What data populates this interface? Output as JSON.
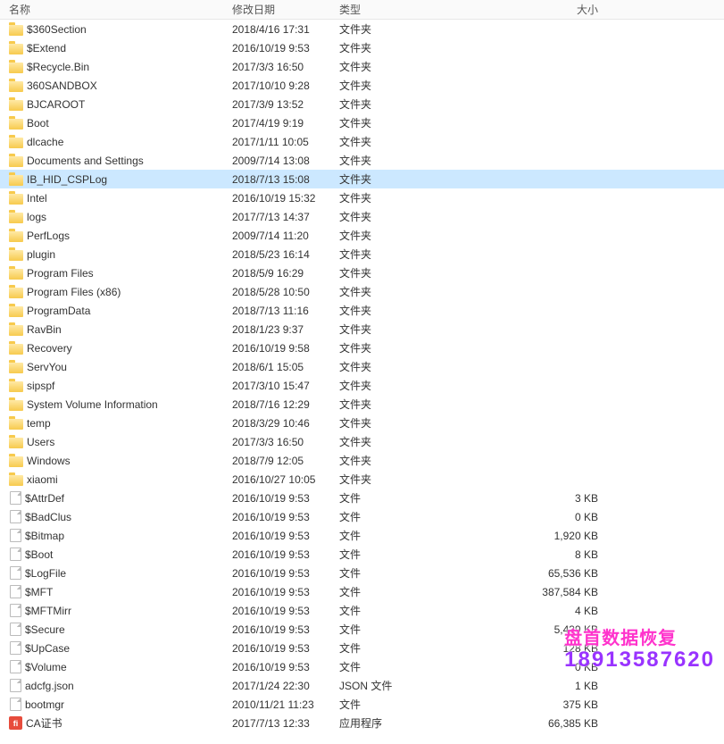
{
  "headers": {
    "name": "名称",
    "date": "修改日期",
    "type": "类型",
    "size": "大小"
  },
  "selected_index": 8,
  "watermark": {
    "line1": "盘首数据恢复",
    "line2": "18913587620"
  },
  "files": [
    {
      "icon": "folder",
      "name": "$360Section",
      "date": "2018/4/16 17:31",
      "type": "文件夹",
      "size": ""
    },
    {
      "icon": "folder",
      "name": "$Extend",
      "date": "2016/10/19 9:53",
      "type": "文件夹",
      "size": ""
    },
    {
      "icon": "folder",
      "name": "$Recycle.Bin",
      "date": "2017/3/3 16:50",
      "type": "文件夹",
      "size": ""
    },
    {
      "icon": "folder",
      "name": "360SANDBOX",
      "date": "2017/10/10 9:28",
      "type": "文件夹",
      "size": ""
    },
    {
      "icon": "folder",
      "name": "BJCAROOT",
      "date": "2017/3/9 13:52",
      "type": "文件夹",
      "size": ""
    },
    {
      "icon": "folder",
      "name": "Boot",
      "date": "2017/4/19 9:19",
      "type": "文件夹",
      "size": ""
    },
    {
      "icon": "folder",
      "name": "dlcache",
      "date": "2017/1/11 10:05",
      "type": "文件夹",
      "size": ""
    },
    {
      "icon": "folder",
      "name": "Documents and Settings",
      "date": "2009/7/14 13:08",
      "type": "文件夹",
      "size": ""
    },
    {
      "icon": "folder",
      "name": "IB_HID_CSPLog",
      "date": "2018/7/13 15:08",
      "type": "文件夹",
      "size": ""
    },
    {
      "icon": "folder",
      "name": "Intel",
      "date": "2016/10/19 15:32",
      "type": "文件夹",
      "size": ""
    },
    {
      "icon": "folder",
      "name": "logs",
      "date": "2017/7/13 14:37",
      "type": "文件夹",
      "size": ""
    },
    {
      "icon": "folder",
      "name": "PerfLogs",
      "date": "2009/7/14 11:20",
      "type": "文件夹",
      "size": ""
    },
    {
      "icon": "folder",
      "name": "plugin",
      "date": "2018/5/23 16:14",
      "type": "文件夹",
      "size": ""
    },
    {
      "icon": "folder",
      "name": "Program Files",
      "date": "2018/5/9 16:29",
      "type": "文件夹",
      "size": ""
    },
    {
      "icon": "folder",
      "name": "Program Files (x86)",
      "date": "2018/5/28 10:50",
      "type": "文件夹",
      "size": ""
    },
    {
      "icon": "folder",
      "name": "ProgramData",
      "date": "2018/7/13 11:16",
      "type": "文件夹",
      "size": ""
    },
    {
      "icon": "folder",
      "name": "RavBin",
      "date": "2018/1/23 9:37",
      "type": "文件夹",
      "size": ""
    },
    {
      "icon": "folder",
      "name": "Recovery",
      "date": "2016/10/19 9:58",
      "type": "文件夹",
      "size": ""
    },
    {
      "icon": "folder",
      "name": "ServYou",
      "date": "2018/6/1 15:05",
      "type": "文件夹",
      "size": ""
    },
    {
      "icon": "folder",
      "name": "sipspf",
      "date": "2017/3/10 15:47",
      "type": "文件夹",
      "size": ""
    },
    {
      "icon": "folder",
      "name": "System Volume Information",
      "date": "2018/7/16 12:29",
      "type": "文件夹",
      "size": ""
    },
    {
      "icon": "folder",
      "name": "temp",
      "date": "2018/3/29 10:46",
      "type": "文件夹",
      "size": ""
    },
    {
      "icon": "folder",
      "name": "Users",
      "date": "2017/3/3 16:50",
      "type": "文件夹",
      "size": ""
    },
    {
      "icon": "folder",
      "name": "Windows",
      "date": "2018/7/9 12:05",
      "type": "文件夹",
      "size": ""
    },
    {
      "icon": "folder",
      "name": "xiaomi",
      "date": "2016/10/27 10:05",
      "type": "文件夹",
      "size": ""
    },
    {
      "icon": "file",
      "name": "$AttrDef",
      "date": "2016/10/19 9:53",
      "type": "文件",
      "size": "3 KB"
    },
    {
      "icon": "file",
      "name": "$BadClus",
      "date": "2016/10/19 9:53",
      "type": "文件",
      "size": "0 KB"
    },
    {
      "icon": "file",
      "name": "$Bitmap",
      "date": "2016/10/19 9:53",
      "type": "文件",
      "size": "1,920 KB"
    },
    {
      "icon": "file",
      "name": "$Boot",
      "date": "2016/10/19 9:53",
      "type": "文件",
      "size": "8 KB"
    },
    {
      "icon": "file",
      "name": "$LogFile",
      "date": "2016/10/19 9:53",
      "type": "文件",
      "size": "65,536 KB"
    },
    {
      "icon": "file",
      "name": "$MFT",
      "date": "2016/10/19 9:53",
      "type": "文件",
      "size": "387,584 KB"
    },
    {
      "icon": "file",
      "name": "$MFTMirr",
      "date": "2016/10/19 9:53",
      "type": "文件",
      "size": "4 KB"
    },
    {
      "icon": "file",
      "name": "$Secure",
      "date": "2016/10/19 9:53",
      "type": "文件",
      "size": "5,439 KB"
    },
    {
      "icon": "file",
      "name": "$UpCase",
      "date": "2016/10/19 9:53",
      "type": "文件",
      "size": "128 KB"
    },
    {
      "icon": "file",
      "name": "$Volume",
      "date": "2016/10/19 9:53",
      "type": "文件",
      "size": "0 KB"
    },
    {
      "icon": "file",
      "name": "adcfg.json",
      "date": "2017/1/24 22:30",
      "type": "JSON 文件",
      "size": "1 KB"
    },
    {
      "icon": "file",
      "name": "bootmgr",
      "date": "2010/11/21 11:23",
      "type": "文件",
      "size": "375 KB"
    },
    {
      "icon": "app",
      "name": "CA证书",
      "date": "2017/7/13 12:33",
      "type": "应用程序",
      "size": "66,385 KB"
    }
  ]
}
